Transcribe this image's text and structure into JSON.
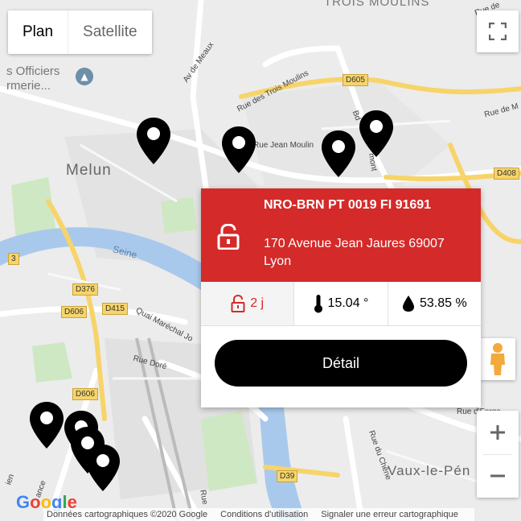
{
  "map_type": {
    "plan_label": "Plan",
    "satellite_label": "Satellite",
    "active": "Plan"
  },
  "place_labels": {
    "trois_moulins": "TROIS MOULINS",
    "officiers": "s Officiers",
    "marmerie": "rmerie...",
    "melun": "Melun",
    "seine": "Seine",
    "vaux": "Vaux-le-Pén"
  },
  "street_labels": {
    "av_meaux": "Av de Meaux",
    "trois_moulins_rue": "Rue des Trois Moulins",
    "jean_moulin": "Rue Jean Moulin",
    "bd": "Bd",
    "mont": "mont",
    "rue_de_m": "Rue de M",
    "quai_marechal": "Quai Maréchal Jo",
    "rue_dore": "Rue Doré",
    "rue_chene": "Rue du Chêne",
    "rue_forge": "Rue d'Forge",
    "rue_de": "Rue de",
    "rue_left": "ien",
    "rue_ance": "ance",
    "rue_bottom": "Rue"
  },
  "road_badges": {
    "d605": "D605",
    "d408": "D408",
    "d376": "D376",
    "d606a": "D606",
    "d415": "D415",
    "d606b": "D606",
    "d39": "D39",
    "three": "3"
  },
  "info_window": {
    "title": "NRO-BRN PT 0019 FI 91691",
    "address": "170 Avenue Jean Jaures 69007 Lyon",
    "lock_status": "2 j",
    "temperature": "15.04 °",
    "humidity": "53.85 %",
    "detail_button": "Détail"
  },
  "footer": {
    "google": "Google",
    "map_data": "Données cartographiques ©2020 Google",
    "terms": "Conditions d'utilisation",
    "report": "Signaler une erreur cartographique"
  },
  "colors": {
    "accent_red": "#d42a2a",
    "pin": "#000000",
    "road_yellow": "#f7d46a",
    "water": "#a9c9ec",
    "park": "#cde8c3"
  }
}
